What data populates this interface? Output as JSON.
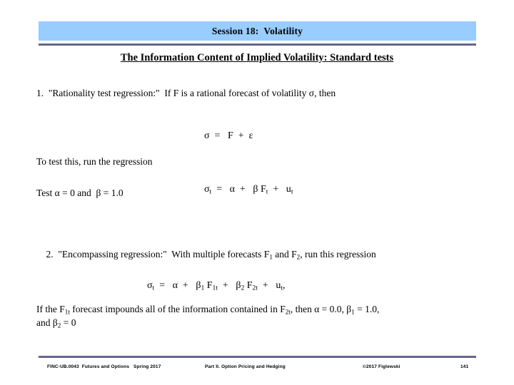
{
  "slide": {
    "title": "Session 18:  Volatility",
    "subtitle": "The Information Content of Implied Volatility: Standard tests",
    "accent_banner_color": "#99ccff",
    "rule_color": "#666688",
    "background_color": "#ffffff",
    "text_color": "#000000"
  },
  "content": {
    "item1_intro": "1.  \"Rationality test regression:\"  If F is a rational forecast of volatility σ, then",
    "equation1": "σ  =   F  +  ε",
    "item1_run": "To test this, run the regression",
    "equation2_sigma": "σ",
    "equation2_sigma_sub": "t",
    "equation2_mid": "  =   α  +   β F",
    "equation2_f_sub": "t",
    "equation2_tail": "  +   u",
    "equation2_u_sub": "t",
    "item1_test_pre": "Test α = 0 and  β = 1.0",
    "item2_intro_a": "2.  \"Encompassing regression:\"  With multiple forecasts F",
    "item2_sub1": "1",
    "item2_intro_b": " and F",
    "item2_sub2": "2",
    "item2_intro_c": ", run this regression",
    "equation3_sigma": "σ",
    "equation3_sigma_sub": "t",
    "equation3_a": "  =   α  +   β",
    "equation3_b1_sub": "1",
    "equation3_b": " F",
    "equation3_f1_sub": "1t",
    "equation3_c": "  +   β",
    "equation3_b2_sub": "2",
    "equation3_d": " F",
    "equation3_f2_sub": "2t",
    "equation3_e": "  +   u",
    "equation3_u_sub": "t",
    "equation3_f": ",",
    "closing_a": "If  the F",
    "closing_sub1": "1t",
    "closing_b": " forecast impounds all of the information contained in F",
    "closing_sub2": "2t",
    "closing_c": ", then  α = 0.0,  β",
    "closing_sub3": "1",
    "closing_d": " = 1.0,",
    "closing_e": "and  β",
    "closing_sub4": "2",
    "closing_f": " = 0"
  },
  "footer": {
    "course": "FINC-UB.0043  Futures and Options   Spring 2017",
    "part": "Part II. Option Pricing and Hedging",
    "copyright": "©2017 Figlewski",
    "page": "141"
  }
}
